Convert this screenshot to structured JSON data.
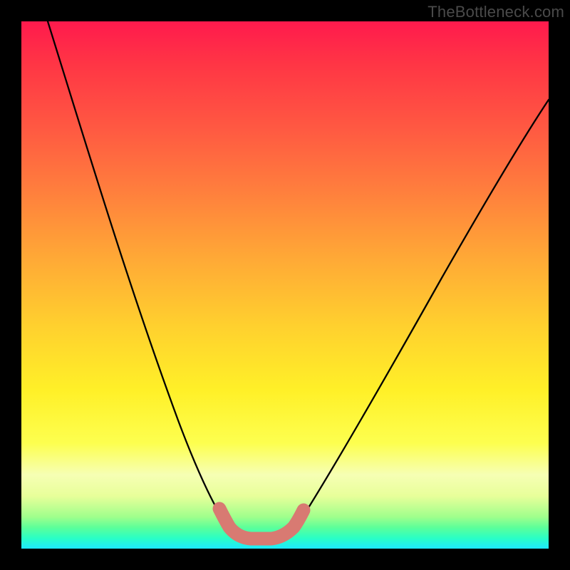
{
  "watermark": "TheBottleneck.com",
  "chart_data": {
    "type": "line",
    "title": "",
    "xlabel": "",
    "ylabel": "",
    "xlim": [
      0,
      100
    ],
    "ylim": [
      0,
      100
    ],
    "series": [
      {
        "name": "bottleneck-curve",
        "x": [
          5,
          10,
          15,
          20,
          25,
          30,
          35,
          38,
          40,
          42,
          44,
          46,
          48,
          50,
          55,
          60,
          65,
          70,
          75,
          80,
          85,
          90,
          95,
          100
        ],
        "y": [
          100,
          84,
          69,
          55,
          42,
          30,
          18,
          10,
          5,
          2,
          1,
          1,
          2,
          4,
          12,
          21,
          29,
          37,
          44,
          51,
          57,
          63,
          68,
          73
        ]
      }
    ],
    "annotations": [
      {
        "name": "trough-marker",
        "x_range": [
          38,
          50
        ],
        "y": 3
      }
    ],
    "background_gradient": {
      "top": "#ff1a4d",
      "mid": "#fff028",
      "bottom": "#1ee8ff"
    }
  }
}
